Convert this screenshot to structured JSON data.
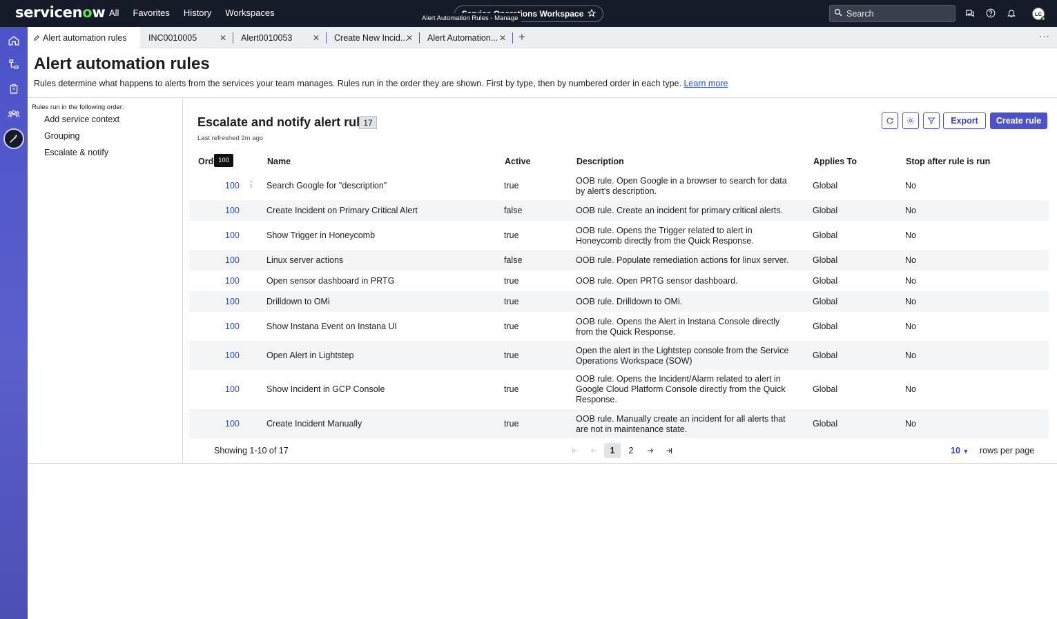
{
  "header": {
    "logo_text_a": "servicen",
    "logo_text_o": "o",
    "logo_text_b": "w",
    "nav": [
      "All",
      "Favorites",
      "History",
      "Workspaces"
    ],
    "workspace_name": "Service Operations Workspace",
    "tooltip": "Alert Automation Rules - Manage",
    "search_placeholder": "Search",
    "avatar_initials": "LC"
  },
  "tabs": [
    {
      "label": "Alert automation rules"
    },
    {
      "label": "INC0010005"
    },
    {
      "label": "Alert0010053"
    },
    {
      "label": "Create New Incid..."
    },
    {
      "label": "Alert Automation..."
    }
  ],
  "tab_more": "···",
  "page": {
    "title": "Alert automation rules",
    "description": "Rules determine what happens to alerts from the services your team manages. Rules run in the order they are shown. First by type, then by numbered order in each type.",
    "learn_more": "Learn more"
  },
  "left_pane": {
    "caption": "Rules run in the following order:",
    "items": [
      "Add service context",
      "Grouping",
      "Escalate & notify"
    ]
  },
  "list": {
    "title": "Escalate and notify alert rules",
    "count": "17",
    "refreshed": "Last refreshed 2m ago",
    "export_label": "Export",
    "create_label": "Create rule",
    "order_tooltip": "100",
    "columns": {
      "order": "Order",
      "name": "Name",
      "active": "Active",
      "description": "Description",
      "applies_to": "Applies To",
      "stop": "Stop after rule is run"
    },
    "rows": [
      {
        "order": "100",
        "name": "Search Google for \"description\"",
        "active": "true",
        "description": "OOB rule. Open Google in a browser to search for data by alert's description.",
        "applies_to": "Global",
        "stop": "No"
      },
      {
        "order": "100",
        "name": "Create Incident on Primary Critical Alert",
        "active": "false",
        "description": "OOB rule. Create an incident for primary critical alerts.",
        "applies_to": "Global",
        "stop": "No"
      },
      {
        "order": "100",
        "name": "Show Trigger in Honeycomb",
        "active": "true",
        "description": "OOB rule. Opens the Trigger related to alert in Honeycomb directly from the Quick Response.",
        "applies_to": "Global",
        "stop": "No"
      },
      {
        "order": "100",
        "name": "Linux server actions",
        "active": "false",
        "description": "OOB rule. Populate remediation actions for linux server.",
        "applies_to": "Global",
        "stop": "No"
      },
      {
        "order": "100",
        "name": "Open sensor dashboard in PRTG",
        "active": "true",
        "description": "OOB rule. Open PRTG sensor dashboard.",
        "applies_to": "Global",
        "stop": "No"
      },
      {
        "order": "100",
        "name": "Drilldown to OMi",
        "active": "true",
        "description": "OOB rule. Drilldown to OMi.",
        "applies_to": "Global",
        "stop": "No"
      },
      {
        "order": "100",
        "name": "Show Instana Event on Instana UI",
        "active": "true",
        "description": "OOB rule. Opens the Alert in Instana Console directly from the Quick Response.",
        "applies_to": "Global",
        "stop": "No"
      },
      {
        "order": "100",
        "name": "Open Alert in Lightstep",
        "active": "true",
        "description": "Open the alert in the Lightstep console from the Service Operations Workspace (SOW)",
        "applies_to": "Global",
        "stop": "No"
      },
      {
        "order": "100",
        "name": "Show Incident in GCP Console",
        "active": "true",
        "description": "OOB rule. Opens the Incident/Alarm related to alert in Google Cloud Platform Console directly from the Quick Response.",
        "applies_to": "Global",
        "stop": "No"
      },
      {
        "order": "100",
        "name": "Create Incident Manually",
        "active": "true",
        "description": "OOB rule. Manually create an incident for all alerts that are not in maintenance state.",
        "applies_to": "Global",
        "stop": "No"
      }
    ]
  },
  "pagination": {
    "showing": "Showing 1-10 of 17",
    "pages": [
      "1",
      "2"
    ],
    "current": "1",
    "rows_per_page_value": "10",
    "rows_per_page_label": "rows per page"
  },
  "colors": {
    "header_bg": "#161b2a",
    "accent": "#4c53c9",
    "link": "#2a4bc2",
    "logo_green": "#62d84e"
  }
}
